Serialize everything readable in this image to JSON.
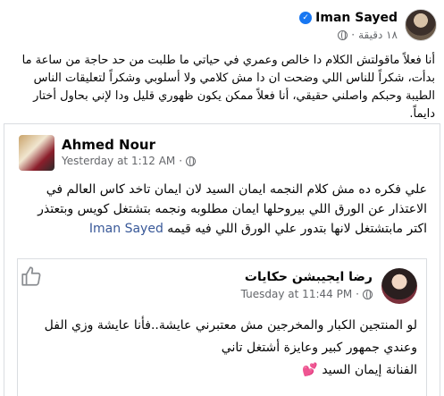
{
  "main_post": {
    "author": "Iman Sayed",
    "time": "١٨ دقيقة",
    "time_separator": "·",
    "text": "أنا فعلاً ماقولتش الكلام دا خالص وعمري في حياتي ما طلبت من حد حاجة من ساعة ما بدأت، شكراً للناس اللي وضحت ان دا مش كلامي ولا أسلوبي وشكراً لتعليقات الناس الطيبة وحبكم واصلني حقيقي، أنا فعلاً ممكن يكون ظهوري قليل ودا لإني بحاول أختار دايماً."
  },
  "shared_post": {
    "author": "Ahmed Nour",
    "time": "Yesterday at 1:12 AM",
    "time_separator": "·",
    "text_before_mention": "علي فكره ده مش كلام النجمه ايمان السيد لان ايمان تاخد كاس العالم في الاعتذار عن الورق اللي بيروحلها ايمان مطلوبه ونجمه بتشتغل كويس وبتعتذر اكتر مابتشتغل لانها بتدور علي الورق اللي فيه قيمه",
    "mention": "Iman Sayed"
  },
  "quoted_post": {
    "author": "رضا ايجيبشن حكايات",
    "time": "Tuesday at 11:44 PM",
    "time_separator": "·",
    "text": "لو المنتجين الكبار والمخرجين مش معتبرني عايشة..فأنا عايشة وزي الفل وعندي جمهور كبير وعايزة أشتغل تاني",
    "signature": "الفنانة إيمان السيد",
    "signature_emoji": "💕"
  }
}
